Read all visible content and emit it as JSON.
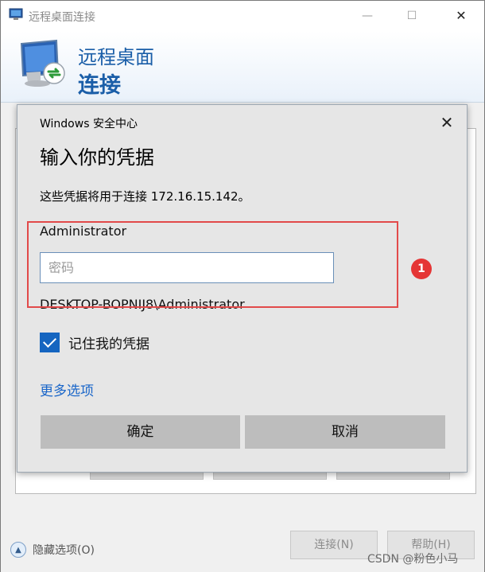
{
  "window": {
    "title": "远程桌面连接",
    "minimize_glyph": "—",
    "maximize_glyph": "☐",
    "close_glyph": "✕",
    "icon": "remote-desktop-icon"
  },
  "banner": {
    "line1": "远程桌面",
    "line2": "连接",
    "icon": "remote-desktop-monitor-icon"
  },
  "bottom": {
    "options_toggle": "隐藏选项(O)",
    "connect": "连接(N)",
    "help": "帮助(H)"
  },
  "watermark": "CSDN @粉色小马",
  "dialog": {
    "header": "Windows 安全中心",
    "close_glyph": "✕",
    "heading": "输入你的凭据",
    "description": "这些凭据将用于连接 172.16.15.142。",
    "username": "Administrator",
    "password_placeholder": "密码",
    "password_value": "",
    "domain_user": "DESKTOP-BOPNIJ8\\Administrator",
    "remember_label": "记住我的凭据",
    "remember_checked": true,
    "more_options": "更多选项",
    "ok_button": "确定",
    "cancel_button": "取消"
  },
  "annotation": {
    "badge": "1",
    "color": "#e53535"
  },
  "colors": {
    "accent": "#1565c0",
    "banner_text": "#1a5ea8",
    "link": "#1a66c9"
  }
}
